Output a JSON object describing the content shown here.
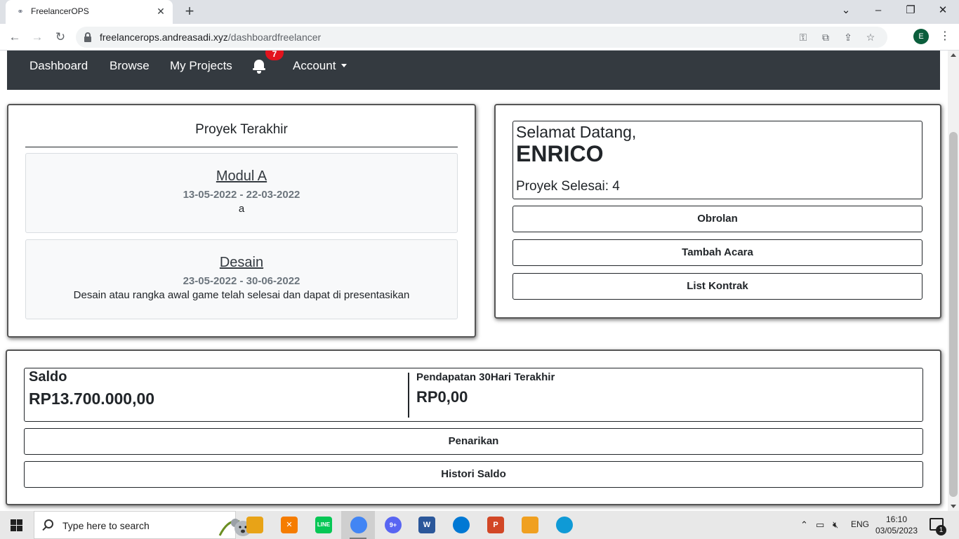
{
  "browser": {
    "tab_title": "FreelancerOPS",
    "url_host": "freelancerops.andreasadi.xyz",
    "url_path": "/dashboardfreelancer",
    "profile_initial": "E"
  },
  "navbar": {
    "links": [
      "Dashboard",
      "Browse",
      "My Projects"
    ],
    "notification_count": "7",
    "account_label": "Account"
  },
  "recent_projects": {
    "title": "Proyek Terakhir",
    "items": [
      {
        "name": "Modul A",
        "dates": "13-05-2022 - 22-03-2022",
        "description": "a"
      },
      {
        "name": "Desain",
        "dates": "23-05-2022 - 30-06-2022",
        "description": "Desain atau rangka awal game telah selesai dan dapat di presentasikan"
      }
    ]
  },
  "welcome": {
    "greeting": "Selamat Datang,",
    "name": "ENRICO",
    "completed_projects": "Proyek Selesai: 4",
    "buttons": [
      "Obrolan",
      "Tambah Acara",
      "List Kontrak"
    ]
  },
  "balance": {
    "saldo_label": "Saldo",
    "saldo_value": "RP13.700.000,00",
    "income_label": "Pendapatan 30Hari Terakhir",
    "income_value": "RP0,00",
    "withdraw_label": "Penarikan",
    "history_label": "Histori Saldo"
  },
  "taskbar": {
    "search_placeholder": "Type here to search",
    "language": "ENG",
    "time": "16:10",
    "date": "03/05/2023",
    "notification_count": "1",
    "apps": [
      {
        "name": "file-explorer",
        "color": "#e8a317",
        "glyph": ""
      },
      {
        "name": "xampp",
        "color": "#f57c00",
        "glyph": "✕"
      },
      {
        "name": "line",
        "color": "#06c755",
        "glyph": "LINE"
      },
      {
        "name": "chrome",
        "color": "#4285f4",
        "glyph": ""
      },
      {
        "name": "discord",
        "color": "#5865f2",
        "glyph": "9+"
      },
      {
        "name": "word",
        "color": "#2b579a",
        "glyph": "W"
      },
      {
        "name": "edge-dev",
        "color": "#0078d4",
        "glyph": ""
      },
      {
        "name": "powerpoint",
        "color": "#d24726",
        "glyph": "P"
      },
      {
        "name": "sketch-app",
        "color": "#f0a020",
        "glyph": ""
      },
      {
        "name": "edge",
        "color": "#0f9ad6",
        "glyph": ""
      }
    ]
  }
}
